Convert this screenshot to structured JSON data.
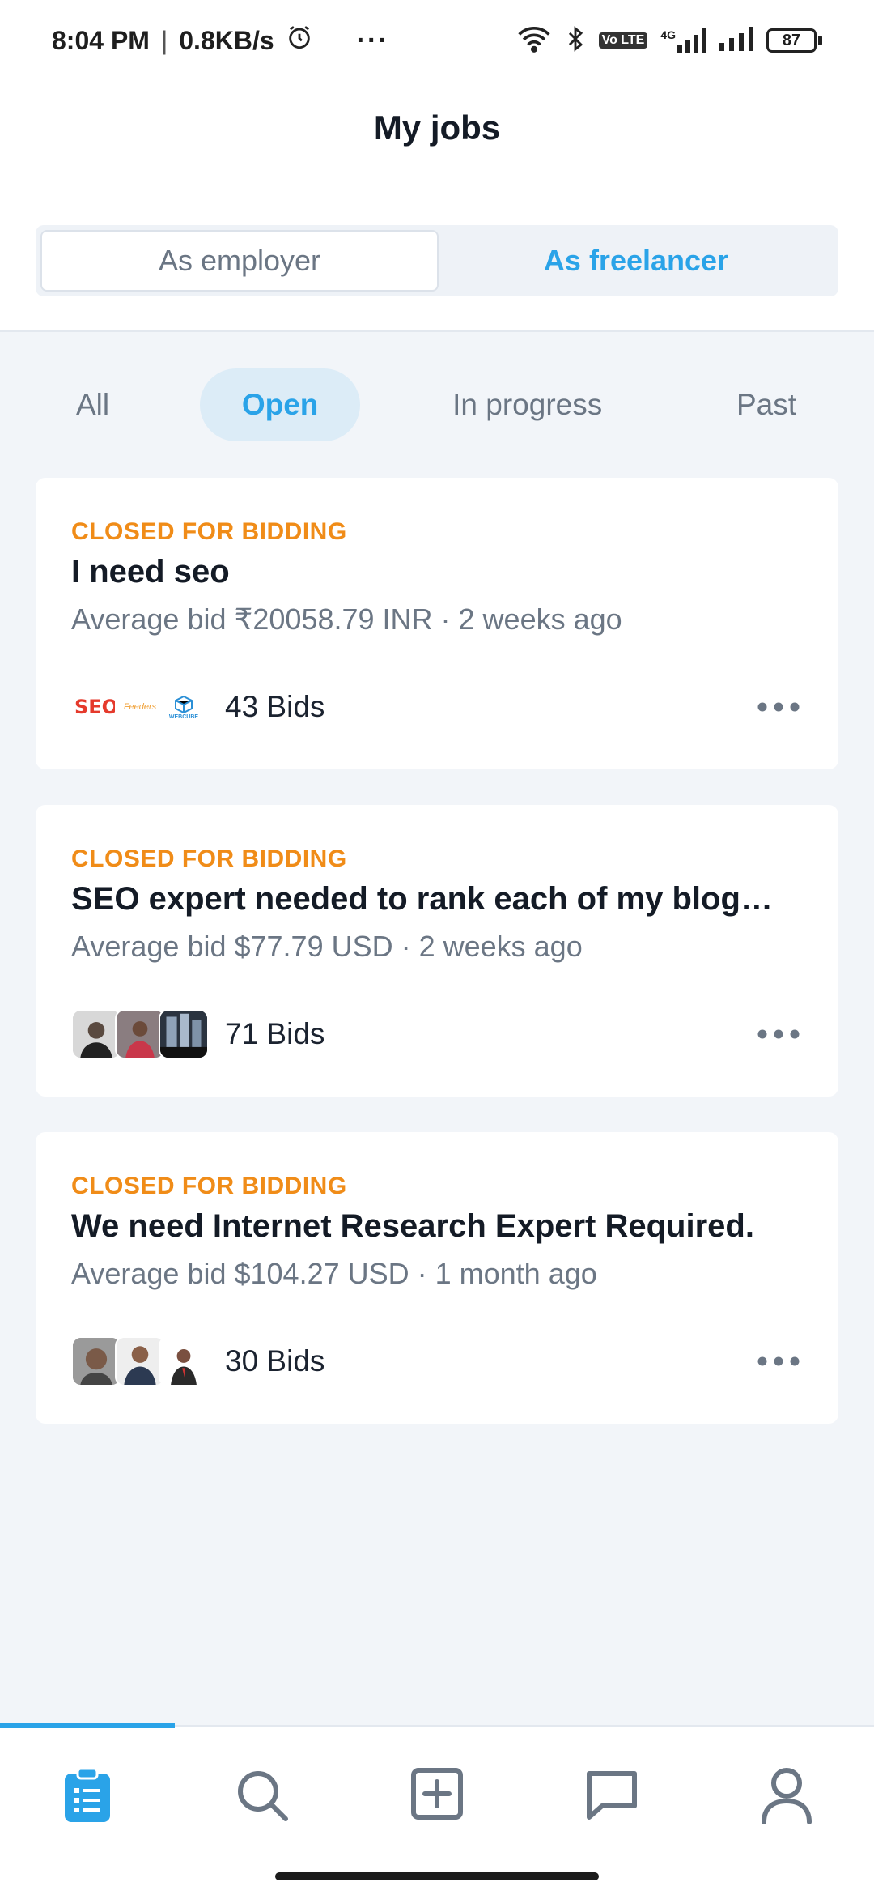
{
  "status_bar": {
    "time": "8:04 PM",
    "speed": "0.8KB/s",
    "more": "···",
    "network": "4G",
    "volte": "Vo LTE",
    "battery": "87"
  },
  "header": {
    "title": "My jobs",
    "segments": [
      "As employer",
      "As freelancer"
    ],
    "selected_segment": "As freelancer"
  },
  "filters": {
    "items": [
      "All",
      "Open",
      "In progress",
      "Past"
    ],
    "selected": "Open"
  },
  "jobs": [
    {
      "status": "CLOSED FOR BIDDING",
      "title": "I need seo",
      "meta": "Average bid ₹20058.79 INR · 2 weeks ago",
      "bids": "43 Bids",
      "avatar_labels": [
        "SEO",
        "Feeders",
        "WEBCUBE"
      ]
    },
    {
      "status": "CLOSED FOR BIDDING",
      "title": "SEO expert needed to rank each of my blog…",
      "meta": "Average bid $77.79 USD · 2 weeks ago",
      "bids": "71 Bids"
    },
    {
      "status": "CLOSED FOR BIDDING",
      "title": "We need Internet Research Expert Required.",
      "meta": "Average bid $104.27 USD · 1 month ago",
      "bids": "30 Bids"
    }
  ],
  "bottom_nav": {
    "items": [
      "my-jobs-icon",
      "search-icon",
      "post-project-icon",
      "messages-icon",
      "profile-icon"
    ],
    "active": "my-jobs-icon"
  },
  "colors": {
    "accent": "#2aa3e8",
    "status_orange": "#f08c18",
    "background": "#f2f5f9"
  }
}
